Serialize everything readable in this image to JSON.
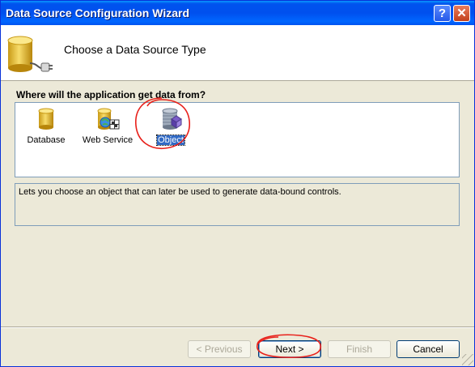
{
  "window": {
    "title": "Data Source Configuration Wizard",
    "help_glyph": "?",
    "close_glyph": "✕"
  },
  "header": {
    "title": "Choose a Data Source Type",
    "icon": "database-plug-icon"
  },
  "question": "Where will the application get data from?",
  "data_sources": [
    {
      "label": "Database",
      "icon": "database-icon",
      "selected": false
    },
    {
      "label": "Web Service",
      "icon": "web-service-icon",
      "selected": false
    },
    {
      "label": "Object",
      "icon": "object-icon",
      "selected": true
    }
  ],
  "description": "Lets you choose an object that can later be used to generate data-bound controls.",
  "buttons": {
    "previous": "< Previous",
    "next": "Next >",
    "finish": "Finish",
    "cancel": "Cancel"
  },
  "colors": {
    "titlebar": "#0053ee",
    "selection": "#316ac5",
    "annotation": "#e8201a"
  }
}
